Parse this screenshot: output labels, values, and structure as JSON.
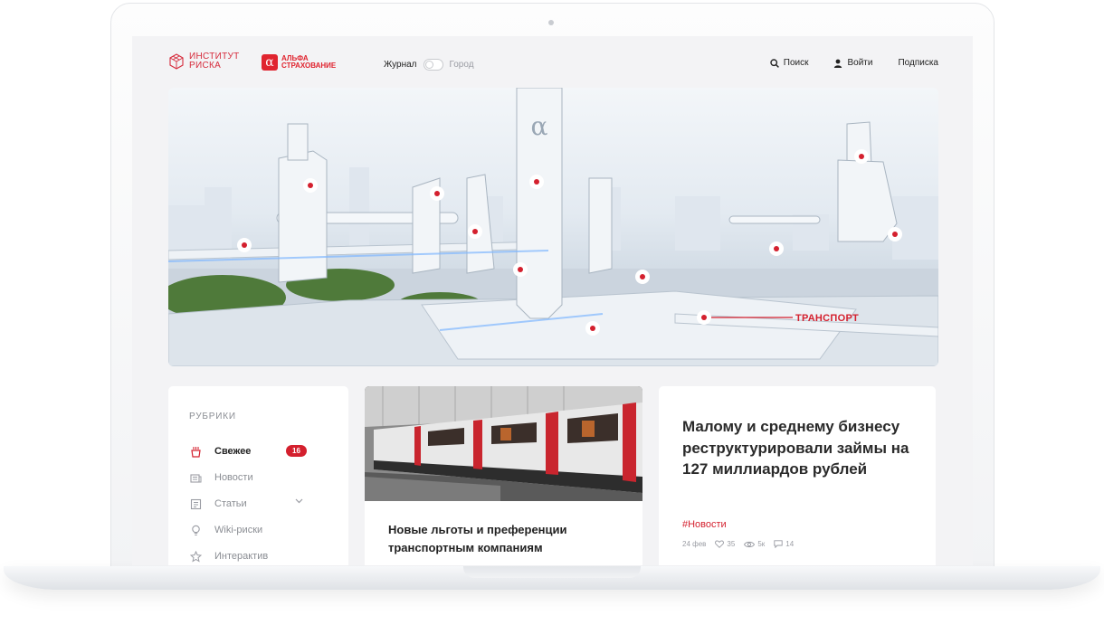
{
  "brand": {
    "institute_line1": "ИНСТИТУТ",
    "institute_line2": "РИСКА",
    "alfa_line1": "АЛЬФА",
    "alfa_line2": "СТРАХОВАНИЕ",
    "alfa_symbol": "α",
    "accent_color": "#d4202e"
  },
  "header": {
    "toggle_left": "Журнал",
    "toggle_right": "Город",
    "search_label": "Поиск",
    "login_label": "Войти",
    "subscribe_label": "Подписка"
  },
  "hero": {
    "hotspot_label": "ТРАНСПОРТ",
    "tower_symbol": "α"
  },
  "sidebar": {
    "title": "РУБРИКИ",
    "items": [
      {
        "label": "Свежее",
        "icon": "fresh-icon",
        "badge": "16",
        "active": true
      },
      {
        "label": "Новости",
        "icon": "news-icon"
      },
      {
        "label": "Статьи",
        "icon": "articles-icon",
        "expandable": true
      },
      {
        "label": "Wiki-риски",
        "icon": "bulb-icon"
      },
      {
        "label": "Интерактив",
        "icon": "star-icon"
      }
    ]
  },
  "cards": {
    "train": {
      "title": "Новые льготы и преференции транспортным компаниям"
    },
    "news": {
      "title": "Малому и среднему бизнесу реструктурировали займы на 127 миллиардов рублей",
      "tag": "#Новости",
      "date": "24 фев",
      "likes": "35",
      "views": "5к",
      "comments": "14"
    }
  }
}
